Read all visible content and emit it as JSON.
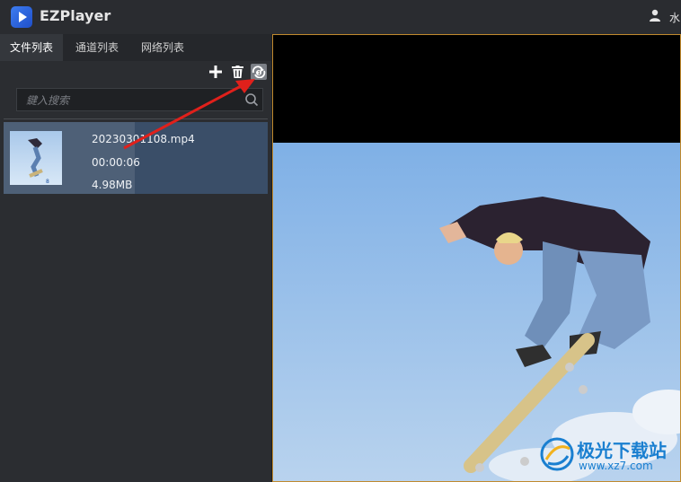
{
  "app": {
    "title": "EZPlayer",
    "user_text": "水"
  },
  "tabs": [
    {
      "label": "文件列表",
      "active": true
    },
    {
      "label": "通道列表",
      "active": false
    },
    {
      "label": "网络列表",
      "active": false
    }
  ],
  "toolbar": {
    "add_icon": "plus-icon",
    "delete_icon": "trash-icon",
    "loop_icon": "loop-one-icon"
  },
  "search": {
    "placeholder": "鍵入搜索",
    "value": ""
  },
  "files": [
    {
      "name": "20230301108.mp4",
      "duration": "00:00:06",
      "size": "4.98MB",
      "thumb_badge": "8"
    }
  ],
  "watermark": {
    "main": "极光下载站",
    "sub": "www.xz7.com"
  },
  "colors": {
    "accent": "#c08a2e",
    "selected_row": "#3a4e68",
    "annotation_arrow": "#e0201b"
  }
}
